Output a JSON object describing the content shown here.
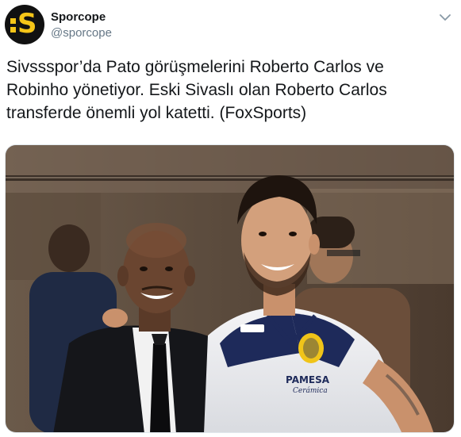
{
  "account": {
    "display_name": "Sporcope",
    "handle": "@sporcope",
    "avatar_icon": "sporcope-logo-icon",
    "brand_color": "#f5c518"
  },
  "menu": {
    "icon": "chevron-down-icon"
  },
  "tweet": {
    "lines": [
      "Sivssspor’da Pato görüşmelerini Roberto Carlos ve",
      "Robinho yönetiyor. Eski Sivaslı olan Roberto Carlos",
      "transferde önemli yol katetti. (FoxSports)"
    ]
  },
  "media": {
    "jersey_sponsor": "PAMESA",
    "jersey_sponsor_sub": "Cerámica"
  }
}
